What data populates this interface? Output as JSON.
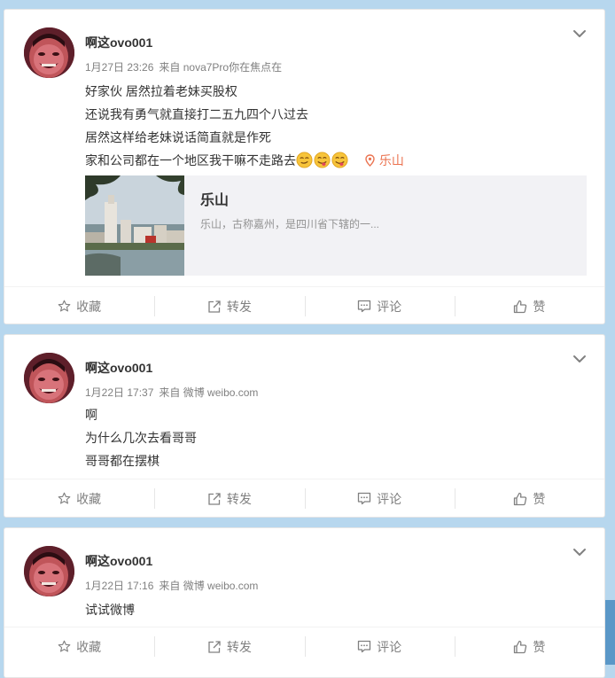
{
  "posts": [
    {
      "username": "啊这ovo001",
      "time": "1月27日 23:26",
      "source": "来自 nova7Pro你在焦点在",
      "lines": [
        "好家伙 居然拉着老妹买股权",
        "还说我有勇气就直接打二五九四个八过去",
        "居然这样给老妹说话简直就是作死",
        "家和公司都在一个地区我干嘛不走路去"
      ],
      "emojis": [
        "smirk-emoji",
        "yum-emoji",
        "yum-emoji"
      ],
      "location": "乐山",
      "link_card": {
        "title": "乐山",
        "description": "乐山，古称嘉州，是四川省下辖的一..."
      }
    },
    {
      "username": "啊这ovo001",
      "time": "1月22日 17:37",
      "source": "来自 微博 weibo.com",
      "lines": [
        "啊",
        "为什么几次去看哥哥",
        "哥哥都在摆棋"
      ]
    },
    {
      "username": "啊这ovo001",
      "time": "1月22日 17:16",
      "source": "来自 微博 weibo.com",
      "lines": [
        "试试微博"
      ]
    }
  ],
  "actions": {
    "favorite": "收藏",
    "repost": "转发",
    "comment": "评论",
    "like": "赞"
  },
  "colors": {
    "background": "#b7d7ee",
    "location": "#eb7350",
    "meta_text": "#808080",
    "side_tab": "#5a97c7"
  }
}
